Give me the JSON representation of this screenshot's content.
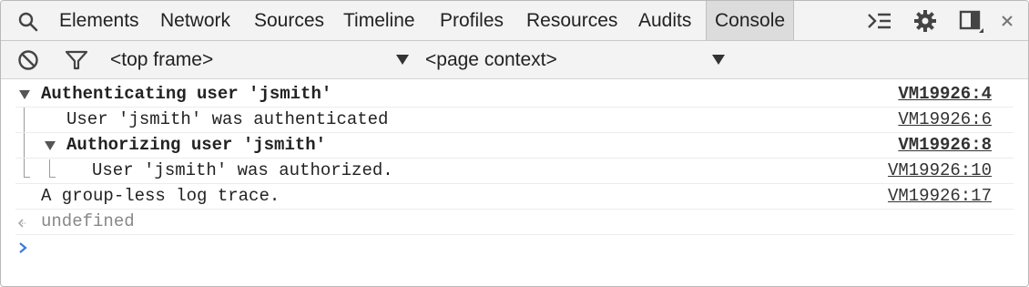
{
  "tabs": [
    {
      "label": "Elements"
    },
    {
      "label": "Network"
    },
    {
      "label": "Sources"
    },
    {
      "label": "Timeline"
    },
    {
      "label": "Profiles"
    },
    {
      "label": "Resources"
    },
    {
      "label": "Audits"
    },
    {
      "label": "Console",
      "selected": true
    }
  ],
  "toolbar_icons": {
    "search": "search-icon",
    "drawer": "show-drawer-icon",
    "settings": "gear-icon",
    "dock": "dock-side-icon",
    "close": "close-icon"
  },
  "filterbar": {
    "clear_icon": "clear-console-icon",
    "filter_icon": "filter-icon",
    "frame_select": "<top frame>",
    "context_select": "<page context>"
  },
  "console": {
    "messages": [
      {
        "text": "Authenticating user 'jsmith'",
        "source": "VM19926:4",
        "group_header": true,
        "expanded": true,
        "level": 0
      },
      {
        "text": "User 'jsmith' was authenticated",
        "source": "VM19926:6",
        "level": 1
      },
      {
        "text": "Authorizing user 'jsmith'",
        "source": "VM19926:8",
        "group_header": true,
        "expanded": true,
        "level": 1
      },
      {
        "text": "User 'jsmith' was authorized.",
        "source": "VM19926:10",
        "level": 2
      },
      {
        "text": "A group-less log trace.",
        "source": "VM19926:17",
        "level": 0
      }
    ],
    "result": "undefined",
    "result_icon": "result-arrow-icon",
    "prompt_icon": "prompt-chevron-icon",
    "colors": {
      "prompt": "#3a7bd5",
      "result_text": "#888888",
      "selected_tab_bg": "#dcdcdc"
    }
  }
}
